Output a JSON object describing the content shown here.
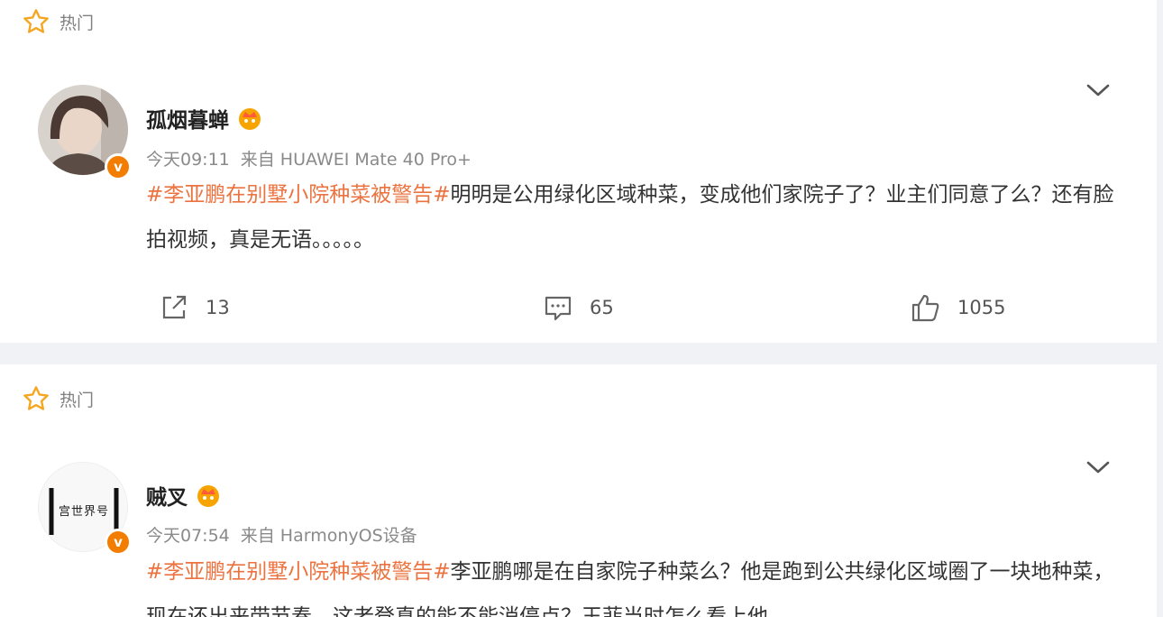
{
  "hot_label": "热门",
  "posts": [
    {
      "username": "孤烟暮蝉",
      "time": "今天09:11",
      "source": "来自 HUAWEI Mate 40 Pro+",
      "hashtag": "#李亚鹏在别墅小院种菜被警告#",
      "text": "明明是公用绿化区域种菜，变成他们家院子了？业主们同意了么？还有脸拍视频，真是无语。。。。。",
      "reposts": "13",
      "comments": "65",
      "likes": "1055"
    },
    {
      "username": "贼叉",
      "time": "今天07:54",
      "source": "来自 HarmonyOS设备",
      "hashtag": "#李亚鹏在别墅小院种菜被警告#",
      "text": "李亚鹏哪是在自家院子种菜么？他是跑到公共绿化区域圈了一块地种菜，现在还出来带节奏，这老登真的能不能消停点？王菲当时怎么看上他",
      "avatar_text": "宫世界号"
    }
  ],
  "colors": {
    "accent": "#eb7340",
    "badge": "#f27d00",
    "star": "#f5a623"
  },
  "icons": [
    "star-icon",
    "verified-icon",
    "crown-icon",
    "chevron-down-icon",
    "share-icon",
    "comment-icon",
    "like-icon"
  ]
}
